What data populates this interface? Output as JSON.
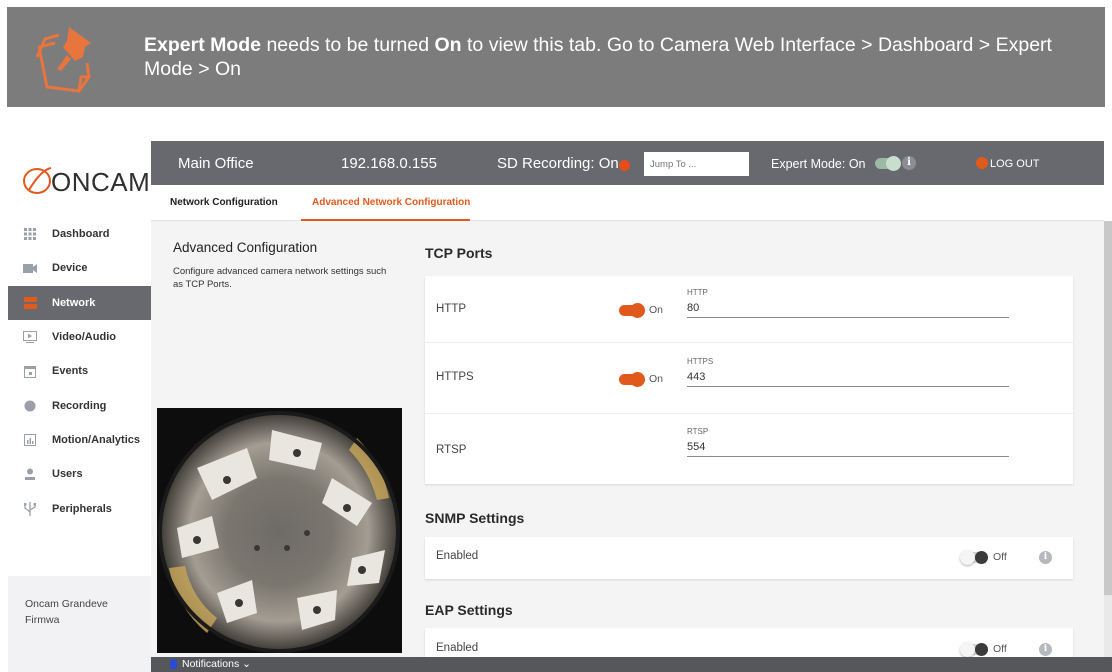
{
  "banner": {
    "part1": "Expert Mode",
    "part2": " needs to be turned ",
    "part3": "On",
    "part4": " to view this tab. Go to Camera Web Interface > Dashboard > Expert Mode > On"
  },
  "logo": {
    "text": "ONCAM"
  },
  "sidebar": {
    "items": [
      {
        "label": "Dashboard",
        "icon": "grid-icon"
      },
      {
        "label": "Device",
        "icon": "camera-icon"
      },
      {
        "label": "Network",
        "icon": "network-icon"
      },
      {
        "label": "Video/Audio",
        "icon": "play-icon"
      },
      {
        "label": "Events",
        "icon": "calendar-icon"
      },
      {
        "label": "Recording",
        "icon": "record-icon"
      },
      {
        "label": "Motion/Analytics",
        "icon": "chart-icon"
      },
      {
        "label": "Users",
        "icon": "user-icon"
      },
      {
        "label": "Peripherals",
        "icon": "usb-icon"
      }
    ],
    "active_index": 2,
    "firmware_line1": "Oncam Grandeve",
    "firmware_line2": "Firmwa"
  },
  "header": {
    "site_name": "Main Office",
    "ip": "192.168.0.155",
    "sd_recording": "SD Recording: On",
    "jump_placeholder": "Jump To ...",
    "expert_mode": "Expert Mode: On",
    "logout": "LOG OUT"
  },
  "tabs": {
    "network_config": "Network Configuration",
    "advanced_config": "Advanced Network Configuration"
  },
  "left_panel": {
    "heading": "Advanced Configuration",
    "description": "Configure advanced camera network settings such as TCP Ports."
  },
  "tcp": {
    "heading": "TCP Ports",
    "rows": [
      {
        "label": "HTTP",
        "switch": "On",
        "field_label": "HTTP",
        "value": "80"
      },
      {
        "label": "HTTPS",
        "switch": "On",
        "field_label": "HTTPS",
        "value": "443"
      },
      {
        "label": "RTSP",
        "field_label": "RTSP",
        "value": "554"
      }
    ]
  },
  "snmp": {
    "heading": "SNMP Settings",
    "enabled_label": "Enabled",
    "switch": "Off"
  },
  "eap": {
    "heading": "EAP Settings",
    "enabled_label": "Enabled",
    "switch": "Off"
  },
  "notifications": {
    "label": "Notifications"
  },
  "colors": {
    "accent": "#e05a1e",
    "header_bg": "#67696e",
    "banner_bg": "#7c7c7c"
  }
}
